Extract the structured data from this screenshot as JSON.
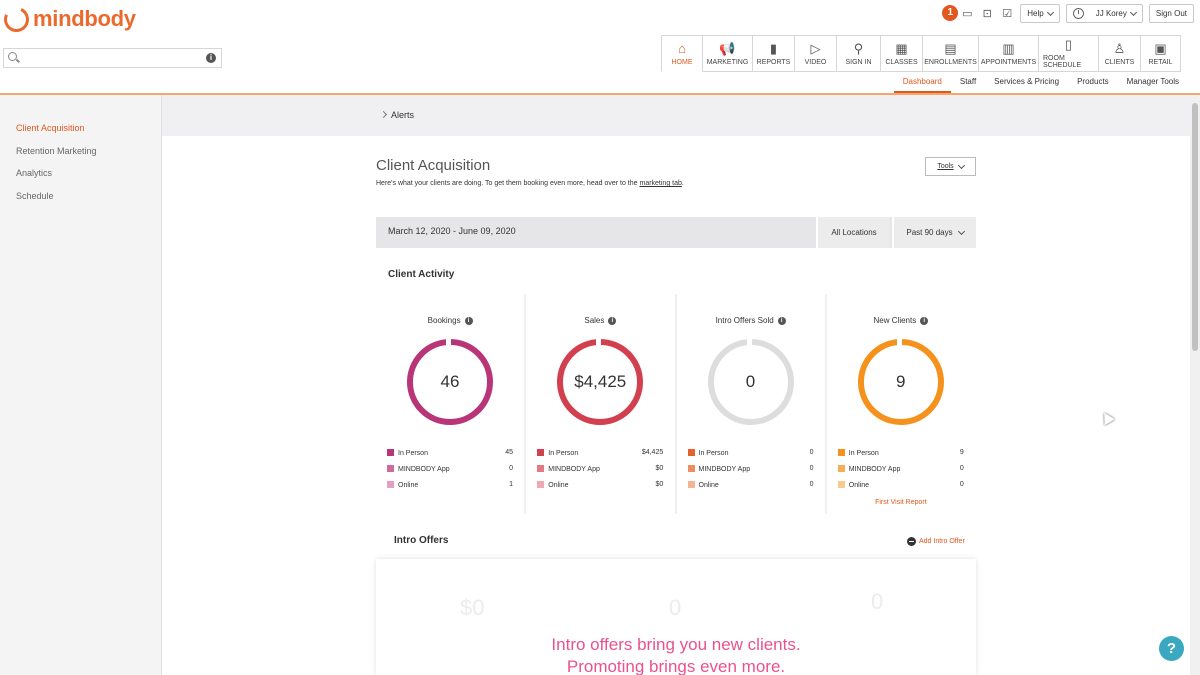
{
  "brand": {
    "name": "mindbody",
    "accent": "#e2571e"
  },
  "search": {
    "placeholder": ""
  },
  "topbar": {
    "notification_count": "1",
    "help_label": "Help",
    "user_label": "JJ Korey",
    "signout_label": "Sign Out"
  },
  "nav": {
    "tabs": [
      {
        "label": "HOME",
        "icon": "home-icon",
        "glyph": "⌂"
      },
      {
        "label": "MARKETING",
        "icon": "megaphone-icon",
        "glyph": "📢"
      },
      {
        "label": "REPORTS",
        "icon": "bar-chart-icon",
        "glyph": "▮"
      },
      {
        "label": "VIDEO",
        "icon": "play-icon",
        "glyph": "▷"
      },
      {
        "label": "SIGN IN",
        "icon": "person-key-icon",
        "glyph": "⚲"
      },
      {
        "label": "CLASSES",
        "icon": "calendar-icon",
        "glyph": "▦"
      },
      {
        "label": "ENROLLMENTS",
        "icon": "list-icon",
        "glyph": "▤"
      },
      {
        "label": "APPOINTMENTS",
        "icon": "appointment-icon",
        "glyph": "▥"
      },
      {
        "label": "ROOM SCHEDULE",
        "icon": "door-icon",
        "glyph": "▯"
      },
      {
        "label": "CLIENTS",
        "icon": "person-icon",
        "glyph": "♙"
      },
      {
        "label": "RETAIL",
        "icon": "cash-register-icon",
        "glyph": "▣"
      }
    ],
    "active_tab": "HOME"
  },
  "subnav": {
    "items": [
      "Dashboard",
      "Staff",
      "Services & Pricing",
      "Products",
      "Manager Tools"
    ],
    "active": "Dashboard"
  },
  "sidebar": {
    "items": [
      "Client Acquisition",
      "Retention Marketing",
      "Analytics",
      "Schedule"
    ],
    "active": "Client Acquisition"
  },
  "alerts": {
    "label": "Alerts"
  },
  "page": {
    "title": "Client Acquisition",
    "desc_prefix": "Here's what your clients are doing. To get them booking even more, head over to the ",
    "desc_link": "marketing tab",
    "desc_suffix": ".",
    "tools_label": "Tools"
  },
  "filters": {
    "date_range": "March 12, 2020 - June 09, 2020",
    "location": "All Locations",
    "period": "Past 90 days"
  },
  "client_activity": {
    "title": "Client Activity",
    "cards": [
      {
        "title": "Bookings",
        "value": "46",
        "ring_color": "#b83578",
        "rows": [
          {
            "label": "In Person",
            "value": "45",
            "color": "#b83578"
          },
          {
            "label": "MINDBODY App",
            "value": "0",
            "color": "#cf6a9d"
          },
          {
            "label": "Online",
            "value": "1",
            "color": "#e3a0c3"
          }
        ]
      },
      {
        "title": "Sales",
        "value": "$4,425",
        "ring_color": "#d2404f",
        "rows": [
          {
            "label": "In Person",
            "value": "$4,425",
            "color": "#d2404f"
          },
          {
            "label": "MINDBODY App",
            "value": "$0",
            "color": "#e07a84"
          },
          {
            "label": "Online",
            "value": "$0",
            "color": "#eeaab0"
          }
        ]
      },
      {
        "title": "Intro Offers Sold",
        "value": "0",
        "ring_color": "#dddddd",
        "rows": [
          {
            "label": "In Person",
            "value": "0",
            "color": "#e8612c"
          },
          {
            "label": "MINDBODY App",
            "value": "0",
            "color": "#ee8d62"
          },
          {
            "label": "Online",
            "value": "0",
            "color": "#f4b597"
          }
        ]
      },
      {
        "title": "New Clients",
        "value": "9",
        "ring_color": "#f5921e",
        "rows": [
          {
            "label": "In Person",
            "value": "9",
            "color": "#f5921e"
          },
          {
            "label": "MINDBODY App",
            "value": "0",
            "color": "#f7ae59"
          },
          {
            "label": "Online",
            "value": "0",
            "color": "#fac98e"
          }
        ],
        "link": "First Visit Report"
      }
    ]
  },
  "intro_offers": {
    "title": "Intro Offers",
    "add_label": "Add Intro Offer",
    "ghost_values": [
      "$0",
      "0",
      "0"
    ],
    "message_line1": "Intro offers bring you new clients.",
    "message_line2": "Promoting brings even more."
  }
}
